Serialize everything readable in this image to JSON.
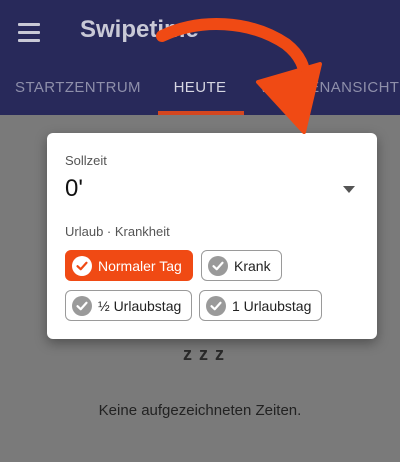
{
  "appbar": {
    "title": "Swipetime",
    "icons": {
      "menu": "hamburger-menu-icon"
    }
  },
  "tabs": [
    {
      "label": "STARTZENTRUM",
      "active": false
    },
    {
      "label": "HEUTE",
      "active": true
    },
    {
      "label": "WOCHENANSICHT",
      "active": false
    }
  ],
  "empty_state": {
    "icon": "zzz-sleep-icon",
    "glyph": "z z z",
    "text": "Keine aufgezeichneten Zeiten."
  },
  "dialog": {
    "target_label": "Sollzeit",
    "target_value": "0'",
    "section_label": "Urlaub · Krankheit",
    "chips": [
      {
        "label": "Normaler Tag",
        "selected": true
      },
      {
        "label": "Krank",
        "selected": false
      },
      {
        "label": "½ Urlaubstag",
        "selected": false
      },
      {
        "label": "1 Urlaubstag",
        "selected": false
      }
    ]
  },
  "colors": {
    "appbar": "#28295a",
    "accent": "#f04a14",
    "tab_indicator": "#d4461f",
    "scrim": "#7a7a7a",
    "annotation_arrow": "#f04a14"
  }
}
